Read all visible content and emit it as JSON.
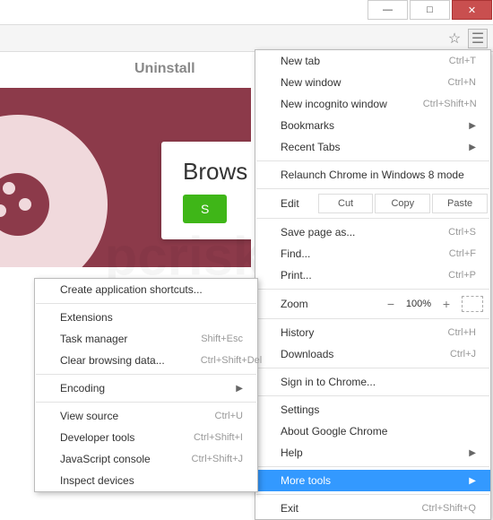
{
  "window": {
    "min": "—",
    "max": "□",
    "close": "✕"
  },
  "page": {
    "uninstall": "Uninstall",
    "heading": "Brows",
    "button": "S"
  },
  "mainMenu": {
    "newTab": "New tab",
    "newTabKey": "Ctrl+T",
    "newWindow": "New window",
    "newWindowKey": "Ctrl+N",
    "newIncognito": "New incognito window",
    "newIncognitoKey": "Ctrl+Shift+N",
    "bookmarks": "Bookmarks",
    "recentTabs": "Recent Tabs",
    "relaunch": "Relaunch Chrome in Windows 8 mode",
    "edit": "Edit",
    "cut": "Cut",
    "copy": "Copy",
    "paste": "Paste",
    "savePage": "Save page as...",
    "savePageKey": "Ctrl+S",
    "find": "Find...",
    "findKey": "Ctrl+F",
    "print": "Print...",
    "printKey": "Ctrl+P",
    "zoom": "Zoom",
    "zoomMinus": "−",
    "zoomVal": "100%",
    "zoomPlus": "+",
    "history": "History",
    "historyKey": "Ctrl+H",
    "downloads": "Downloads",
    "downloadsKey": "Ctrl+J",
    "signIn": "Sign in to Chrome...",
    "settings": "Settings",
    "about": "About Google Chrome",
    "help": "Help",
    "moreTools": "More tools",
    "exit": "Exit",
    "exitKey": "Ctrl+Shift+Q"
  },
  "subMenu": {
    "createShortcuts": "Create application shortcuts...",
    "extensions": "Extensions",
    "taskManager": "Task manager",
    "taskManagerKey": "Shift+Esc",
    "clearData": "Clear browsing data...",
    "clearDataKey": "Ctrl+Shift+Del",
    "encoding": "Encoding",
    "viewSource": "View source",
    "viewSourceKey": "Ctrl+U",
    "devTools": "Developer tools",
    "devToolsKey": "Ctrl+Shift+I",
    "jsConsole": "JavaScript console",
    "jsConsoleKey": "Ctrl+Shift+J",
    "inspect": "Inspect devices"
  }
}
